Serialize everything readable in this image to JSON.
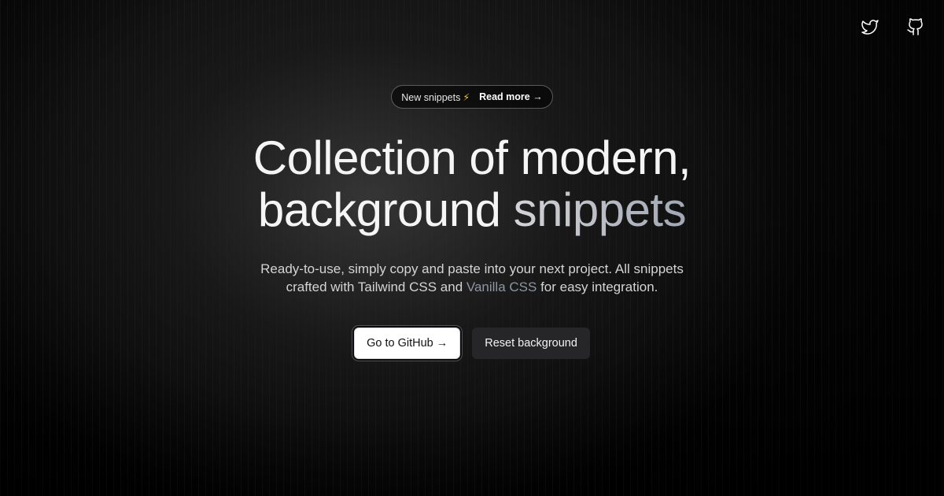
{
  "nav": {
    "twitter_icon": "twitter-icon",
    "github_icon": "github-icon"
  },
  "badge": {
    "label": "New snippets",
    "bolt": "⚡",
    "link": "Read more →"
  },
  "headline": {
    "line1": "Collection of modern,",
    "line2_plain": "background",
    "line2_accent": "snippets"
  },
  "subtext": {
    "line1": "Ready-to-use, simply copy and paste into your next project. All snippets",
    "line2_prefix": "crafted with Tailwind CSS and",
    "line2_muted": "Vanilla CSS",
    "line2_suffix": "for easy integration."
  },
  "buttons": {
    "primary": "Go to GitHub →",
    "secondary": "Reset background"
  },
  "colors": {
    "background": "#000000",
    "accent_text": "#a1a7b3",
    "bolt": "#facc15",
    "secondary_button": "#262628"
  }
}
